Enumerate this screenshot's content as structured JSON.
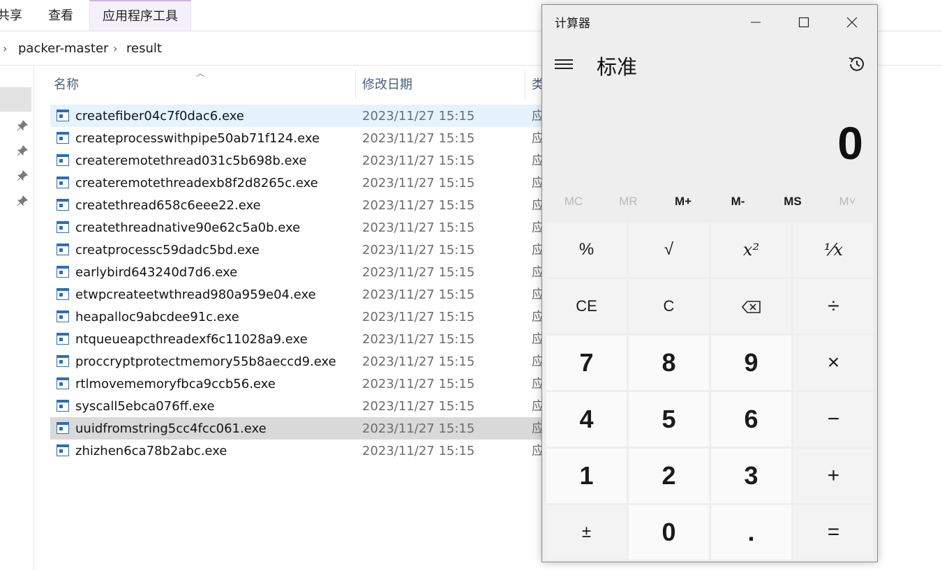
{
  "explorer": {
    "ribbon_tabs": [
      "共享",
      "查看",
      "应用程序工具"
    ],
    "breadcrumb": [
      "packer-master",
      "result"
    ],
    "columns": {
      "name": "名称",
      "date": "修改日期",
      "type": "类"
    },
    "files": [
      {
        "name": "createfiber04c7f0dac6.exe",
        "date": "2023/11/27 15:15",
        "type": "应"
      },
      {
        "name": "createprocesswithpipe50ab71f124.exe",
        "date": "2023/11/27 15:15",
        "type": "应"
      },
      {
        "name": "createremotethread031c5b698b.exe",
        "date": "2023/11/27 15:15",
        "type": "应"
      },
      {
        "name": "createremotethreadexb8f2d8265c.exe",
        "date": "2023/11/27 15:15",
        "type": "应"
      },
      {
        "name": "createthread658c6eee22.exe",
        "date": "2023/11/27 15:15",
        "type": "应"
      },
      {
        "name": "createthreadnative90e62c5a0b.exe",
        "date": "2023/11/27 15:15",
        "type": "应"
      },
      {
        "name": "creatprocessc59dadc5bd.exe",
        "date": "2023/11/27 15:15",
        "type": "应"
      },
      {
        "name": "earlybird643240d7d6.exe",
        "date": "2023/11/27 15:15",
        "type": "应"
      },
      {
        "name": "etwpcreateetwthread980a959e04.exe",
        "date": "2023/11/27 15:15",
        "type": "应"
      },
      {
        "name": "heapalloc9abcdee91c.exe",
        "date": "2023/11/27 15:15",
        "type": "应"
      },
      {
        "name": "ntqueueapcthreadexf6c11028a9.exe",
        "date": "2023/11/27 15:15",
        "type": "应"
      },
      {
        "name": "proccryptprotectmemory55b8aeccd9.exe",
        "date": "2023/11/27 15:15",
        "type": "应"
      },
      {
        "name": "rtlmovememoryfbca9ccb56.exe",
        "date": "2023/11/27 15:15",
        "type": "应"
      },
      {
        "name": "syscall5ebca076ff.exe",
        "date": "2023/11/27 15:15",
        "type": "应"
      },
      {
        "name": "uuidfromstring5cc4fcc061.exe",
        "date": "2023/11/27 15:15",
        "type": "应"
      },
      {
        "name": "zhizhen6ca78b2abc.exe",
        "date": "2023/11/27 15:15",
        "type": "应"
      }
    ]
  },
  "calculator": {
    "title": "计算器",
    "mode": "标准",
    "display": "0",
    "memory": [
      {
        "label": "MC",
        "enabled": false
      },
      {
        "label": "MR",
        "enabled": false
      },
      {
        "label": "M+",
        "enabled": true
      },
      {
        "label": "M-",
        "enabled": true
      },
      {
        "label": "MS",
        "enabled": true
      },
      {
        "label": "M˅",
        "enabled": false
      }
    ],
    "keys": {
      "percent": "%",
      "sqrt": "√",
      "square": "x²",
      "reciprocal": "¹⁄x",
      "ce": "CE",
      "clear": "C",
      "backspace": "⌫",
      "divide": "÷",
      "seven": "7",
      "eight": "8",
      "nine": "9",
      "multiply": "×",
      "four": "4",
      "five": "5",
      "six": "6",
      "minus": "−",
      "one": "1",
      "two": "2",
      "three": "3",
      "plus": "+",
      "negate": "±",
      "zero": "0",
      "decimal": ".",
      "equals": "="
    }
  }
}
